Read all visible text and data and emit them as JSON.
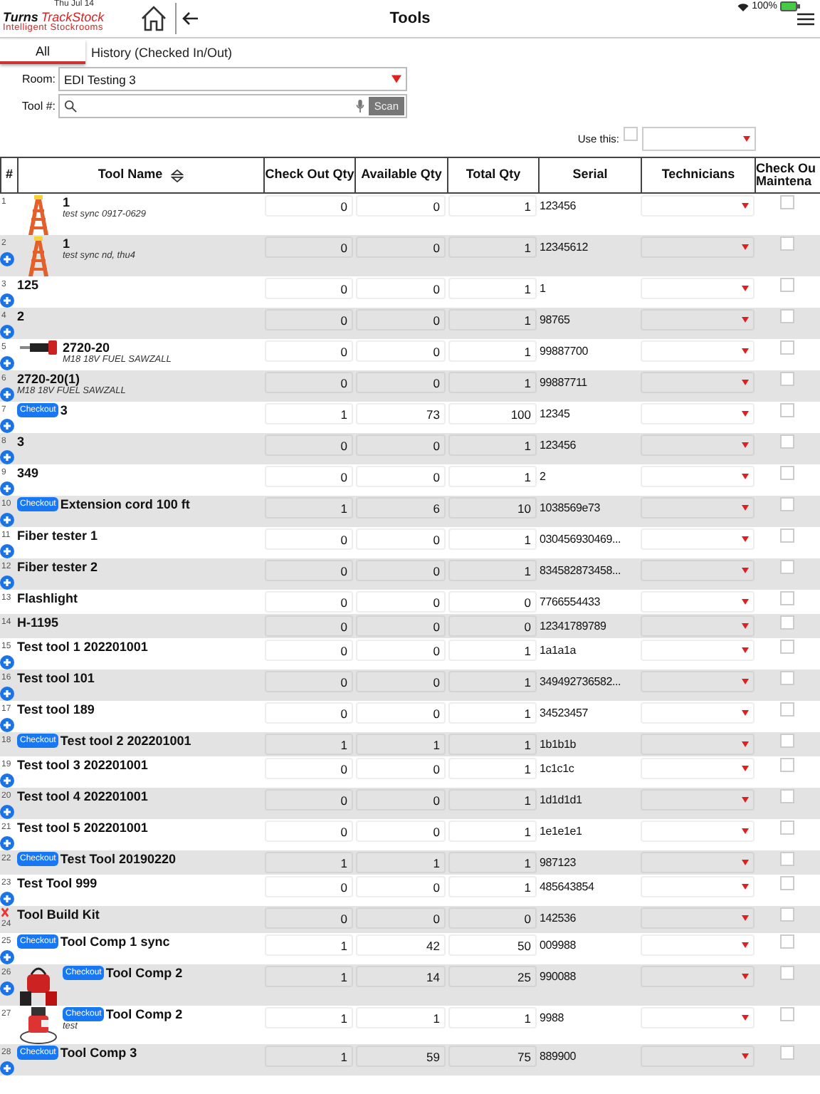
{
  "status_bar": {
    "date": "Thu Jul 14",
    "battery": "100%"
  },
  "logo": {
    "brand": "Turns",
    "product": "TrackStock",
    "tagline": "Intelligent Stockrooms"
  },
  "title": "Tools",
  "tabs": [
    {
      "label": "All",
      "selected": true
    },
    {
      "label": "History (Checked In/Out)",
      "selected": false
    }
  ],
  "room": {
    "label": "Room:",
    "value": "EDI Testing 3"
  },
  "tool_search": {
    "label": "Tool #:",
    "button": "Scan"
  },
  "use_this": {
    "label": "Use this:",
    "checked": false
  },
  "columns": [
    "#",
    "Tool Name",
    "Check Out Qty",
    "Available Qty",
    "Total Qty",
    "Serial",
    "Technicians",
    "Check Ou Maintena"
  ],
  "rows": [
    {
      "number": "1",
      "name": "1",
      "subtitle": "test sync 0917-0629",
      "picture": true,
      "add": false,
      "check_out_qty": "0",
      "available_qty": "0",
      "total_qty": "1",
      "serial": "123456",
      "maintenance_checked": false
    },
    {
      "number": "2",
      "name": "1",
      "subtitle": "test sync nd, thu4",
      "picture": true,
      "add": true,
      "check_out_qty": "0",
      "available_qty": "0",
      "total_qty": "1",
      "serial": "12345612",
      "maintenance_checked": false
    },
    {
      "number": "3",
      "name": "125",
      "add": true,
      "check_out_qty": "0",
      "available_qty": "0",
      "total_qty": "1",
      "serial": "1",
      "maintenance_checked": false
    },
    {
      "number": "4",
      "name": "2",
      "add": true,
      "check_out_qty": "0",
      "available_qty": "0",
      "total_qty": "1",
      "serial": "98765",
      "maintenance_checked": false
    },
    {
      "number": "5",
      "name": "2720-20",
      "subtitle": "M18 18V FUEL SAWZALL",
      "picture": true,
      "add": true,
      "check_out_qty": "0",
      "available_qty": "0",
      "total_qty": "1",
      "serial": "99887700",
      "maintenance_checked": false
    },
    {
      "number": "6",
      "name": "2720-20(1)",
      "subtitle": "M18 18V FUEL SAWZALL",
      "add": true,
      "check_out_qty": "0",
      "available_qty": "0",
      "total_qty": "1",
      "serial": "99887711",
      "maintenance_checked": false
    },
    {
      "number": "7",
      "name": "3",
      "checkout": "Checkout",
      "add": true,
      "check_out_qty": "1",
      "available_qty": "73",
      "total_qty": "100",
      "serial": "12345",
      "maintenance_checked": false
    },
    {
      "number": "8",
      "name": "3",
      "add": true,
      "check_out_qty": "0",
      "available_qty": "0",
      "total_qty": "1",
      "serial": "123456",
      "maintenance_checked": false
    },
    {
      "number": "9",
      "name": "349",
      "add": true,
      "check_out_qty": "0",
      "available_qty": "0",
      "total_qty": "1",
      "serial": "2",
      "maintenance_checked": false
    },
    {
      "number": "10",
      "name": "Extension cord 100 ft",
      "checkout": "Checkout",
      "add": true,
      "check_out_qty": "1",
      "available_qty": "6",
      "total_qty": "10",
      "serial": "1038569e73",
      "maintenance_checked": false
    },
    {
      "number": "11",
      "name": "Fiber tester 1",
      "add": true,
      "check_out_qty": "0",
      "available_qty": "0",
      "total_qty": "1",
      "serial": "030456930469...",
      "maintenance_checked": false
    },
    {
      "number": "12",
      "name": "Fiber tester 2",
      "add": true,
      "check_out_qty": "0",
      "available_qty": "0",
      "total_qty": "1",
      "serial": "834582873458...",
      "maintenance_checked": false
    },
    {
      "number": "13",
      "name": "Flashlight",
      "add": false,
      "check_out_qty": "0",
      "available_qty": "0",
      "total_qty": "0",
      "serial": "7766554433",
      "maintenance_checked": false
    },
    {
      "number": "14",
      "name": "H-1195",
      "add": false,
      "check_out_qty": "0",
      "available_qty": "0",
      "total_qty": "0",
      "serial": "12341789789",
      "maintenance_checked": false
    },
    {
      "number": "15",
      "name": "Test tool 1 202201001",
      "add": true,
      "check_out_qty": "0",
      "available_qty": "0",
      "total_qty": "1",
      "serial": "1a1a1a",
      "maintenance_checked": false
    },
    {
      "number": "16",
      "name": "Test tool 101",
      "add": true,
      "check_out_qty": "0",
      "available_qty": "0",
      "total_qty": "1",
      "serial": "349492736582...",
      "maintenance_checked": false
    },
    {
      "number": "17",
      "name": "Test tool 189",
      "add": true,
      "check_out_qty": "0",
      "available_qty": "0",
      "total_qty": "1",
      "serial": "34523457",
      "maintenance_checked": false
    },
    {
      "number": "18",
      "name": "Test tool 2 202201001",
      "checkout": "Checkout",
      "add": false,
      "check_out_qty": "1",
      "available_qty": "1",
      "total_qty": "1",
      "serial": "1b1b1b",
      "maintenance_checked": false
    },
    {
      "number": "19",
      "name": "Test tool 3 202201001",
      "add": true,
      "check_out_qty": "0",
      "available_qty": "0",
      "total_qty": "1",
      "serial": "1c1c1c",
      "maintenance_checked": false
    },
    {
      "number": "20",
      "name": "Test tool 4 202201001",
      "add": true,
      "check_out_qty": "0",
      "available_qty": "0",
      "total_qty": "1",
      "serial": "1d1d1d1",
      "maintenance_checked": false
    },
    {
      "number": "21",
      "name": "Test tool 5 202201001",
      "add": true,
      "check_out_qty": "0",
      "available_qty": "0",
      "total_qty": "1",
      "serial": "1e1e1e1",
      "maintenance_checked": false
    },
    {
      "number": "22",
      "name": "Test Tool 20190220",
      "checkout": "Checkout",
      "add": false,
      "check_out_qty": "1",
      "available_qty": "1",
      "total_qty": "1",
      "serial": "987123",
      "maintenance_checked": false
    },
    {
      "number": "23",
      "name": "Test Tool 999",
      "add": true,
      "check_out_qty": "0",
      "available_qty": "0",
      "total_qty": "1",
      "serial": "485643854",
      "maintenance_checked": false
    },
    {
      "number": "24",
      "name": "Tool Build Kit",
      "warning": true,
      "add": false,
      "check_out_qty": "0",
      "available_qty": "0",
      "total_qty": "0",
      "serial": "142536",
      "maintenance_checked": false
    },
    {
      "number": "25",
      "name": "Tool Comp 1 sync",
      "checkout": "Checkout",
      "add": true,
      "check_out_qty": "1",
      "available_qty": "42",
      "total_qty": "50",
      "serial": "009988",
      "maintenance_checked": false
    },
    {
      "number": "26",
      "name": "Tool Comp 2",
      "checkout": "Checkout",
      "picture": true,
      "add": true,
      "check_out_qty": "1",
      "available_qty": "14",
      "total_qty": "25",
      "serial": "990088",
      "maintenance_checked": false
    },
    {
      "number": "27",
      "name": "Tool Comp 2",
      "subtitle": "test",
      "checkout": "Checkout",
      "picture": true,
      "add": false,
      "check_out_qty": "1",
      "available_qty": "1",
      "total_qty": "1",
      "serial": "9988",
      "maintenance_checked": false
    },
    {
      "number": "28",
      "name": "Tool Comp 3",
      "checkout": "Checkout",
      "add": true,
      "check_out_qty": "1",
      "available_qty": "59",
      "total_qty": "75",
      "serial": "889900",
      "maintenance_checked": false
    }
  ]
}
